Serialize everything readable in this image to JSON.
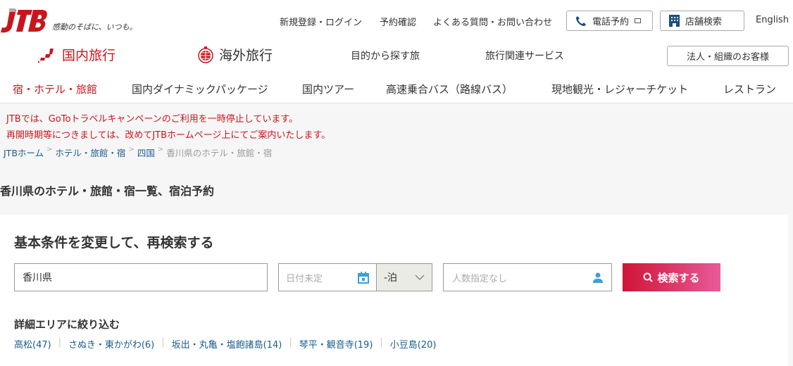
{
  "header": {
    "logo_text": "JTB",
    "tagline": "感動のそばに、いつも。",
    "utility_links": [
      "新規登録・ログイン",
      "予約確認",
      "よくある質問・お問い合わせ"
    ],
    "phone_button": "電話予約",
    "store_button": "店舗検索",
    "english": "English",
    "corporate_button": "法人・組織のお客様"
  },
  "main_nav": {
    "domestic": "国内旅行",
    "overseas": "海外旅行",
    "purpose": "目的から探す旅",
    "services": "旅行関連サービス"
  },
  "sub_nav": [
    "宿・ホテル・旅館",
    "国内ダイナミックパッケージ",
    "国内ツアー",
    "高速乗合バス（路線バス）",
    "現地観光・レジャーチケット",
    "レストラン"
  ],
  "notice": [
    "JTBでは、GoToトラベルキャンペーンのご利用を一時停止しています。",
    "再開時期等につきましては、改めてJTBホームページ上にてご案内いたします。"
  ],
  "breadcrumb": [
    "JTBホーム",
    "ホテル・旅館・宿",
    "四国",
    "香川県のホテル・旅館・宿"
  ],
  "page_title": "香川県のホテル・旅館・宿一覧、宿泊予約",
  "search": {
    "heading": "基本条件を変更して、再検索する",
    "destination_value": "香川県",
    "date_placeholder": "日付未定",
    "nights_value": "-泊",
    "guests_placeholder": "人数指定なし",
    "submit": "検索する"
  },
  "areas": {
    "heading": "詳細エリアに絞り込む",
    "items": [
      "高松(47)",
      "さぬき・東かがわ(6)",
      "坂出・丸亀・塩飽諸島(14)",
      "琴平・観音寺(19)",
      "小豆島(20)"
    ]
  },
  "colors": {
    "brand_red": "#c8161d",
    "link_blue": "#1a5c8c",
    "icon_blue": "#3aa0d8",
    "button_gradient_end": "#e85a9a"
  }
}
